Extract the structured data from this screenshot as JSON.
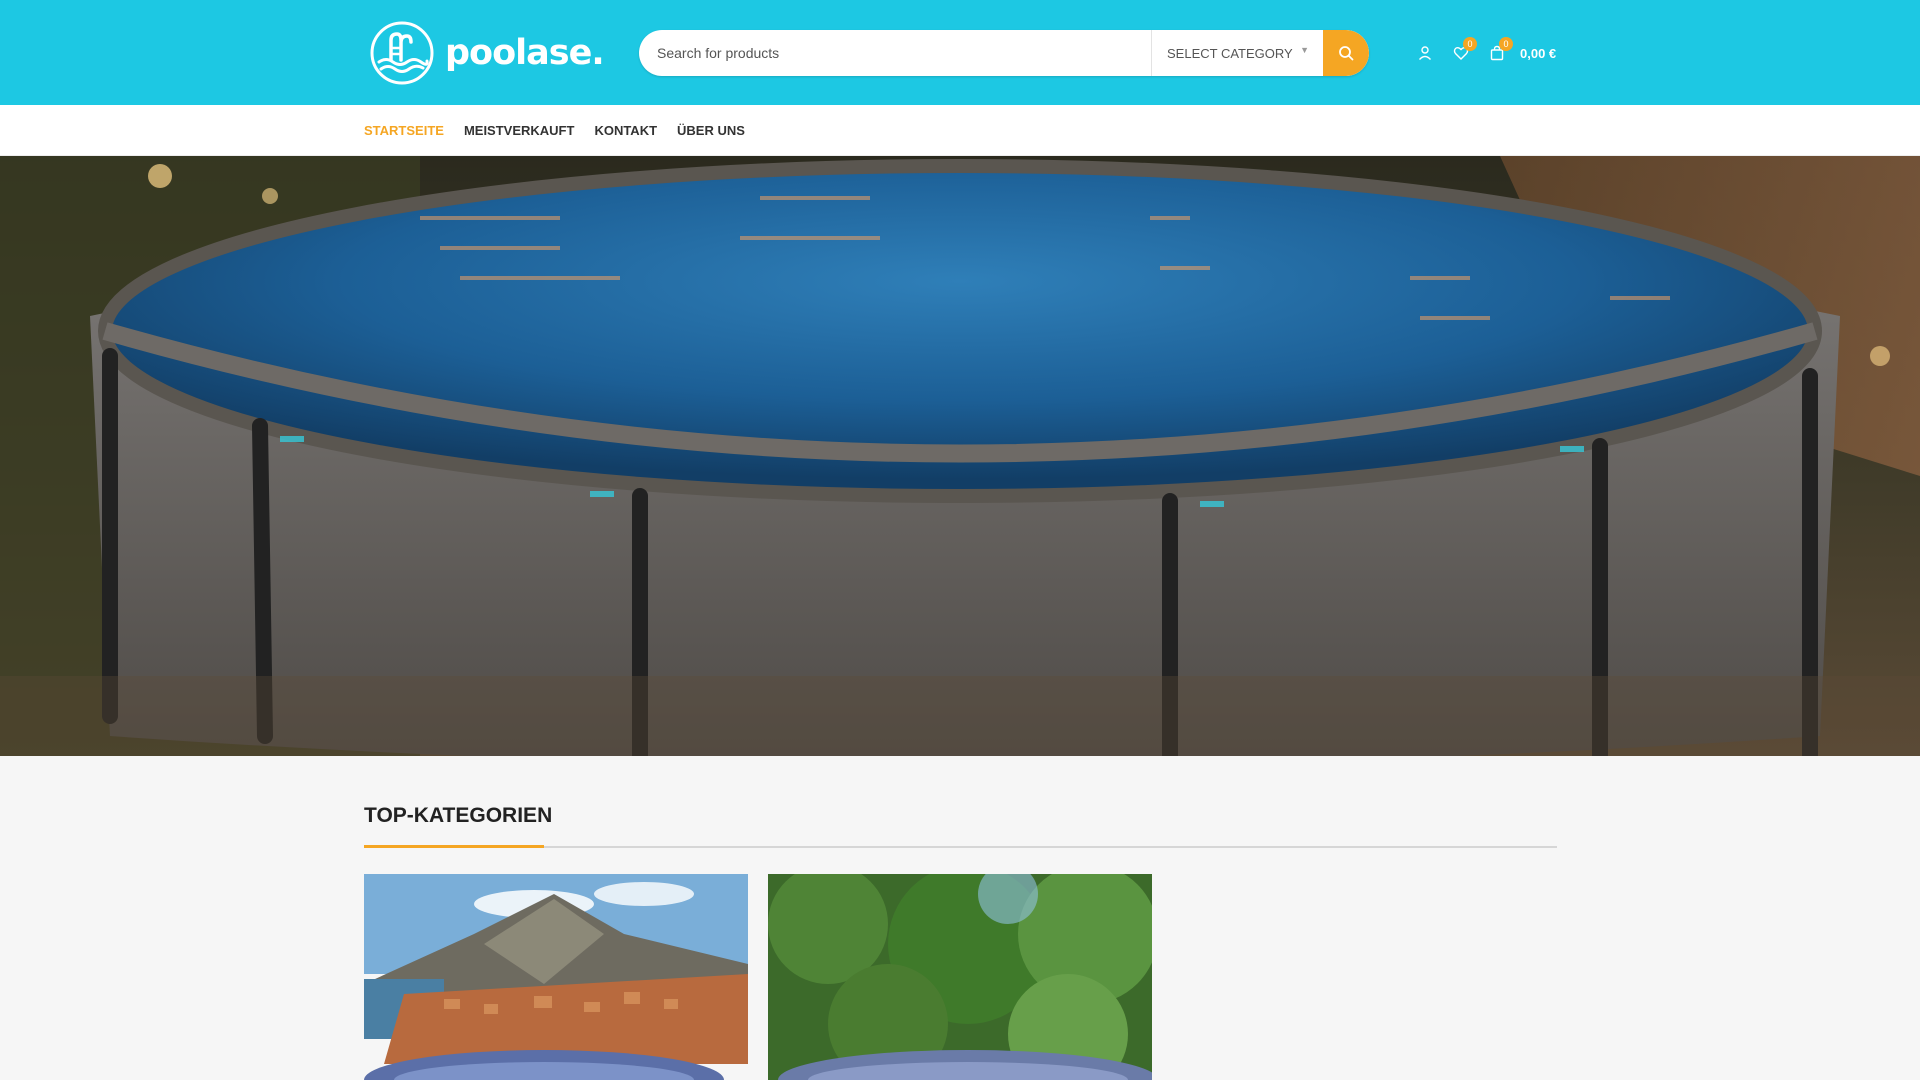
{
  "brand": {
    "name": "poolase.",
    "logo_icon": "pool-ladder-waves-logo"
  },
  "search": {
    "placeholder": "Search for products",
    "category_label": "SELECT CATEGORY",
    "button_icon": "search-icon"
  },
  "header_icons": {
    "account_icon": "user-icon",
    "wishlist": {
      "icon": "heart-icon",
      "count": "0"
    },
    "cart": {
      "icon": "shopping-bag-icon",
      "count": "0",
      "total": "0,00 €"
    }
  },
  "nav": {
    "items": [
      {
        "label": "STARTSEITE",
        "active": true
      },
      {
        "label": "MEISTVERKAUFT",
        "active": false
      },
      {
        "label": "KONTAKT",
        "active": false
      },
      {
        "label": "ÜBER UNS",
        "active": false
      }
    ]
  },
  "sections": {
    "top_categories_title": "TOP-KATEGORIEN"
  },
  "colors": {
    "header_bg": "#1dc8e3",
    "accent": "#f5a623",
    "page_bg": "#f6f6f6"
  }
}
